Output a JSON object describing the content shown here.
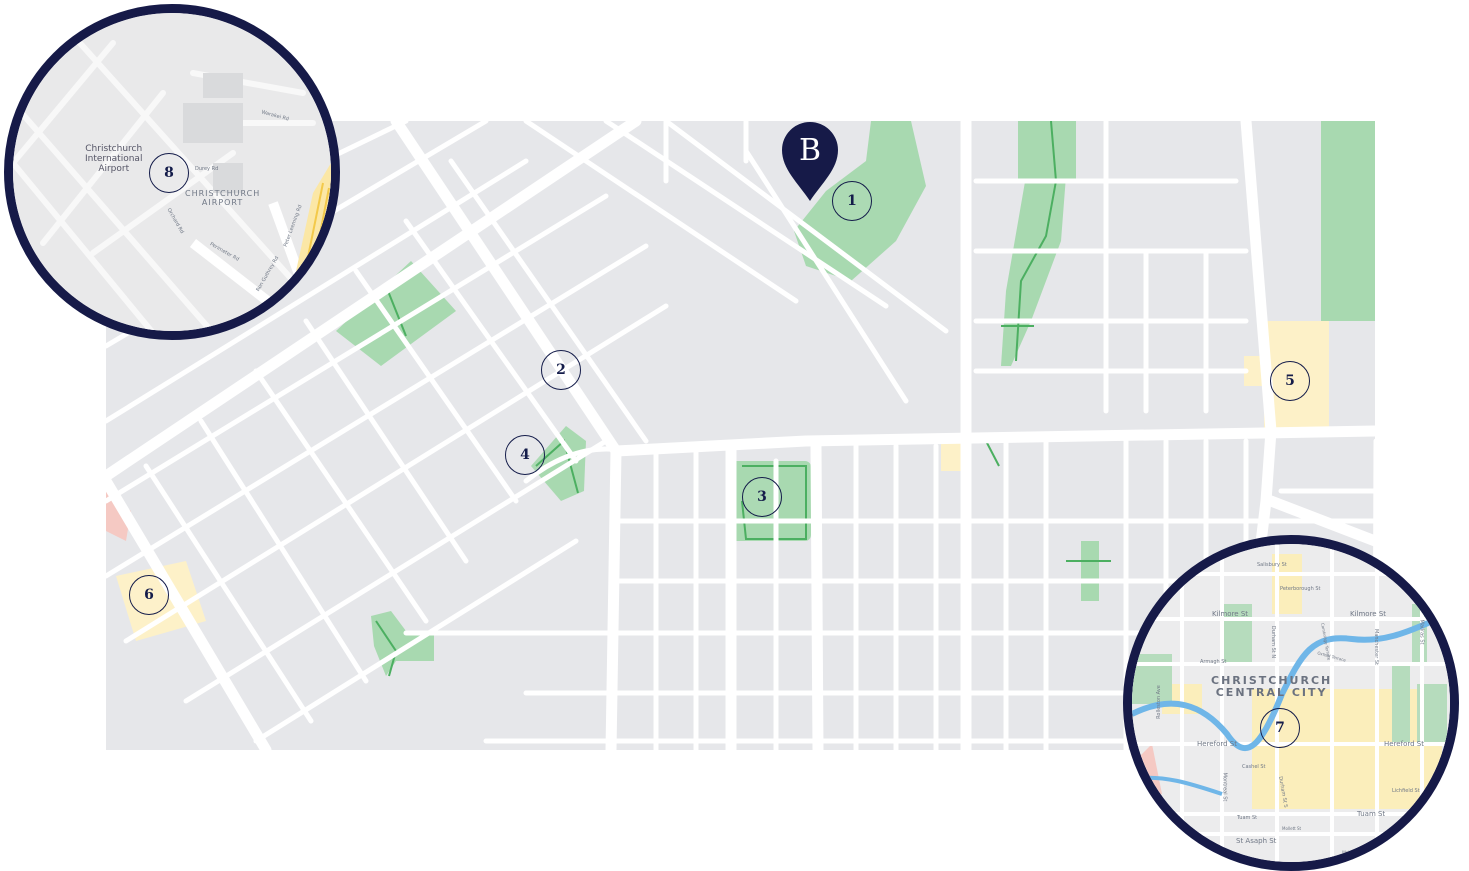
{
  "pin": {
    "label": "B"
  },
  "markers": [
    "1",
    "2",
    "3",
    "4",
    "5",
    "6",
    "7",
    "8"
  ],
  "airport_inset": {
    "place_label": "Christchurch International Airport",
    "place_line1": "Christchurch",
    "place_line2": "International",
    "place_line3": "Airport",
    "area_line1": "CHRISTCHURCH",
    "area_line2": "AIRPORT",
    "streets": [
      "Durey Rd",
      "Orchard Rd",
      "Perimeter Rd",
      "Ron Guthrey Rd",
      "Peter Leeming Rd",
      "Warakei Rd"
    ]
  },
  "city_inset": {
    "area_line1": "CHRISTCHURCH",
    "area_line2": "CENTRAL CITY",
    "streets": {
      "salisbury": "Salisbury St",
      "peterborough": "Peterborough St",
      "kilmore_w": "Kilmore St",
      "kilmore_e": "Kilmore St",
      "armagh": "Armagh St",
      "durham_n": "Durham St N",
      "manchester": "Manchester St",
      "madras": "Madras St",
      "rolleston": "Rolleston Ave",
      "hereford_w": "Hereford St",
      "hereford_e": "Hereford St",
      "cashel": "Cashel St",
      "montreal": "Montreal St",
      "durham_s": "Durham St S",
      "lichfield": "Lichfield St",
      "tuam_w": "Tuam St",
      "tuam_e": "Tuam St",
      "st_asaph": "St Asaph St",
      "mollett": "Mollett St",
      "walker": "Walker St",
      "cambridge": "Cambridge Terrace",
      "oxford": "Oxford Terrace"
    }
  },
  "colors": {
    "navy": "#161a48",
    "land": "#e6e7ea",
    "road": "#ffffff",
    "park": "#a8d9b0",
    "commercial": "#fdf1c8"
  }
}
